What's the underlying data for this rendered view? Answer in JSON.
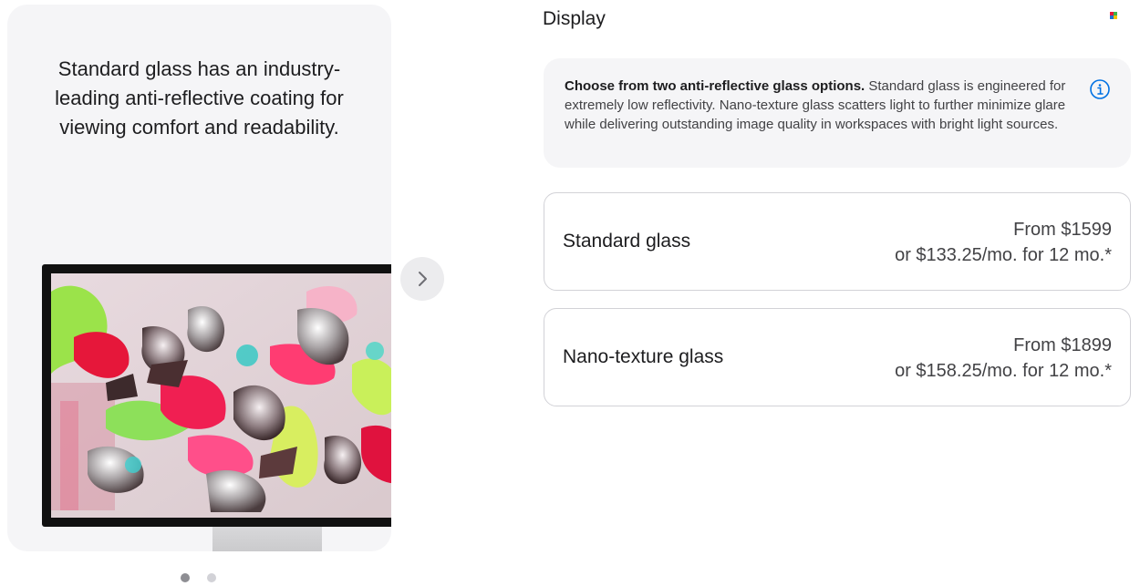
{
  "gallery": {
    "caption": "Standard glass has an industry-leading anti-reflective coating for viewing comfort and readability.",
    "image_alt": "Studio Display with colorful abstract artwork",
    "next_icon": "chevron-right-icon",
    "dots": [
      {
        "active": true
      },
      {
        "active": false
      }
    ]
  },
  "section": {
    "title": "Display"
  },
  "info": {
    "bold": "Choose from two anti-reflective glass options.",
    "text": " Standard glass is engineered for extremely low reflectivity. Nano-texture glass scatters light to further minimize glare while delivering outstanding image quality in workspaces with bright light sources.",
    "icon": "info-circle-icon",
    "icon_color": "#0071e3"
  },
  "options": [
    {
      "name": "Standard glass",
      "price": "From $1599",
      "monthly": "or $133.25/mo. for 12 mo.*"
    },
    {
      "name": "Nano-texture glass",
      "price": "From $1899",
      "monthly": "or $158.25/mo. for 12 mo.*"
    }
  ]
}
